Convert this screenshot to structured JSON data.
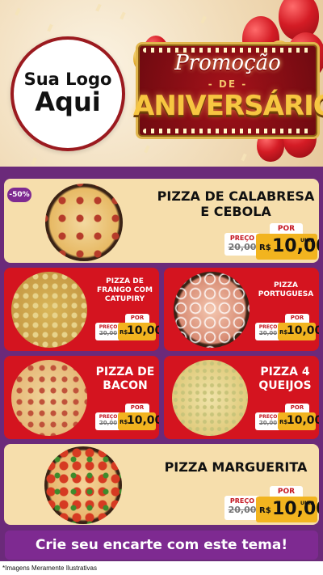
{
  "logo": {
    "line1": "Sua Logo",
    "line2": "Aqui"
  },
  "promo": {
    "title": "Promoção",
    "de": "- DE -",
    "main": "ANIVERSÁRIO"
  },
  "badge": "-50%",
  "labels": {
    "preco": "PREÇO",
    "por": "POR",
    "currency": "R$",
    "unid": "UNID"
  },
  "products": [
    {
      "name": "PIZZA DE CALABRESA E CEBOLA",
      "old_price": "20,00",
      "new_price": "10,00"
    },
    {
      "name": "PIZZA DE FRANGO COM CATUPIRY",
      "old_price": "20,00",
      "new_price": "10,00"
    },
    {
      "name": "PIZZA PORTUGUESA",
      "old_price": "20,00",
      "new_price": "10,00"
    },
    {
      "name": "PIZZA DE BACON",
      "old_price": "20,00",
      "new_price": "10,00"
    },
    {
      "name": "PIZZA 4 QUEIJOS",
      "old_price": "20,00",
      "new_price": "10,00"
    },
    {
      "name": "PIZZA MARGUERITA",
      "old_price": "20,00",
      "new_price": "10,00"
    }
  ],
  "cta": "Crie seu encarte com este tema!",
  "footer": "*Imagens Meramente Ilustrativas",
  "colors": {
    "purple": "#7e2a91",
    "red": "#d4141f",
    "cream": "#f6deac",
    "gold": "#f2b41f"
  }
}
